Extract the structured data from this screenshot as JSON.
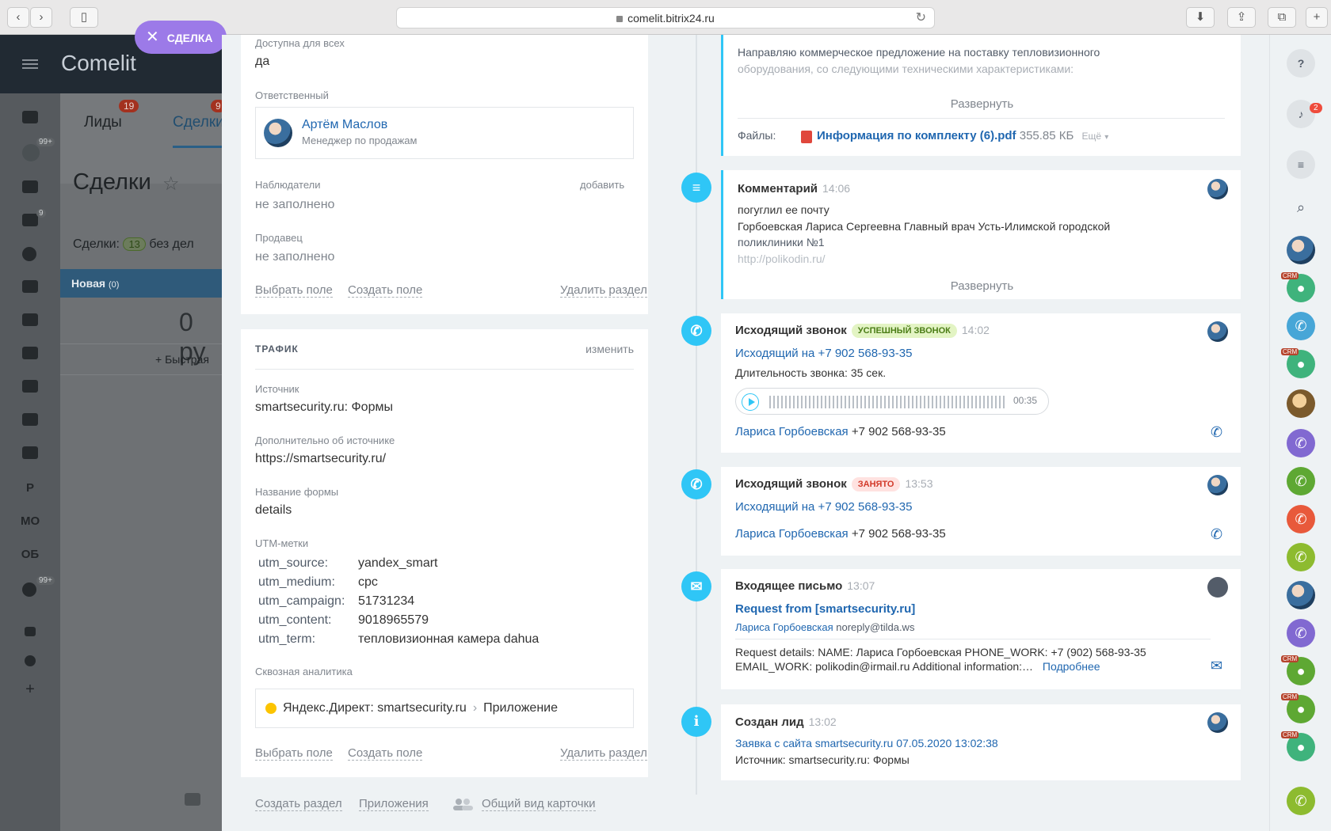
{
  "browser": {
    "url": "comelit.bitrix24.ru",
    "back": "‹",
    "forward": "›",
    "reload": "↻"
  },
  "portal": {
    "logo": "Comelit",
    "deal_pill": "СДЕЛКА",
    "tabs": [
      {
        "label": "Лиды",
        "badge": "19"
      },
      {
        "label": "Сделки",
        "badge": "9"
      }
    ],
    "page_title": "Сделки",
    "counter_label": "Сделки:",
    "counter_value": "13",
    "counter_suffix": "без дел",
    "stage_name": "Новая",
    "stage_count": "(0)",
    "stage_sum": "0 ру",
    "quick_add": "Быстрая",
    "rail_badges": [
      "99+",
      "9",
      "99+"
    ],
    "rail_letters": [
      "Р",
      "МО",
      "ОБ"
    ]
  },
  "fields_card": {
    "available_label": "Доступна для всех",
    "available_value": "да",
    "responsible_label": "Ответственный",
    "responsible_name": "Артём Маслов",
    "responsible_position": "Менеджер по продажам",
    "observers_label": "Наблюдатели",
    "observers_add": "добавить",
    "observers_value": "не заполнено",
    "seller_label": "Продавец",
    "seller_value": "не заполнено",
    "select_field": "Выбрать поле",
    "create_field": "Создать поле",
    "delete_section": "Удалить раздел"
  },
  "traffic_card": {
    "title": "ТРАФИК",
    "edit": "изменить",
    "source_label": "Источник",
    "source_value": "smartsecurity.ru: Формы",
    "source_extra_label": "Дополнительно об источнике",
    "source_extra_value": "https://smartsecurity.ru/",
    "form_name_label": "Название формы",
    "form_name_value": "details",
    "utm_label": "UTM-метки",
    "utm": [
      {
        "key": "utm_source:",
        "value": "yandex_smart"
      },
      {
        "key": "utm_medium:",
        "value": "cpc"
      },
      {
        "key": "utm_campaign:",
        "value": "51731234"
      },
      {
        "key": "utm_content:",
        "value": "9018965579"
      },
      {
        "key": "utm_term:",
        "value": "тепловизионная камера dahua"
      }
    ],
    "analytics_label": "Сквозная аналитика",
    "analytics_source": "Яндекс.Директ: smartsecurity.ru",
    "analytics_sep": "›",
    "analytics_target": "Приложение",
    "select_field": "Выбрать поле",
    "create_field": "Создать поле",
    "delete_section": "Удалить раздел"
  },
  "footer_links": {
    "create_section": "Создать раздел",
    "apps": "Приложения",
    "general_view": "Общий вид карточки"
  },
  "timeline": {
    "email_out": {
      "line1": "Направляю коммерческое предложение на поставку тепловизионного",
      "line2": "оборудования, со следующими техническими характеристиками:",
      "expand": "Развернуть",
      "files_label": "Файлы:",
      "file_name": "Информация по комплекту (6).pdf",
      "file_size": "355.85 КБ",
      "more": "Ещё"
    },
    "comment": {
      "title": "Комментарий",
      "time": "14:06",
      "line1": "погуглил ее почту",
      "line2": "Горбоевская Лариса Сергеевна Главный врач Усть-Илимской городской",
      "line3": "поликлиники №1",
      "line4": "http://polikodin.ru/",
      "expand": "Развернуть"
    },
    "call1": {
      "title": "Исходящий звонок",
      "badge": "УСПЕШНЫЙ ЗВОНОК",
      "time": "14:02",
      "link": "Исходящий на +7 902 568-93-35",
      "duration": "Длительность звонка: 35 сек.",
      "player_time": "00:35",
      "contact": "Лариса Горбоевская",
      "phone": "+7 902 568-93-35"
    },
    "call2": {
      "title": "Исходящий звонок",
      "badge": "ЗАНЯТО",
      "time": "13:53",
      "link": "Исходящий на +7 902 568-93-35",
      "contact": "Лариса Горбоевская",
      "phone": "+7 902 568-93-35"
    },
    "email_in": {
      "title": "Входящее письмо",
      "time": "13:07",
      "subject": "Request from [smartsecurity.ru]",
      "from_name": "Лариса Горбоевская",
      "from_email": "noreply@tilda.ws",
      "body1": "Request details: NAME: Лариса Горбоевская PHONE_WORK: +7 (902) 568-93-35",
      "body2": "EMAIL_WORK: polikodin@irmail.ru Additional information:…",
      "more": "Подробнее"
    },
    "lead": {
      "title": "Создан лид",
      "time": "13:02",
      "link": "Заявка с сайта smartsecurity.ru 07.05.2020 13:02:38",
      "source": "Источник: smartsecurity.ru: Формы"
    }
  },
  "right_bar": {
    "help": "?",
    "notif_badge": "2",
    "crm_tag": "CRM",
    "colors": {
      "green": "#8dbb2f",
      "teal": "#3fb37c",
      "blue": "#47a6d7",
      "purple": "#8169d1",
      "red": "#e8593b"
    }
  }
}
